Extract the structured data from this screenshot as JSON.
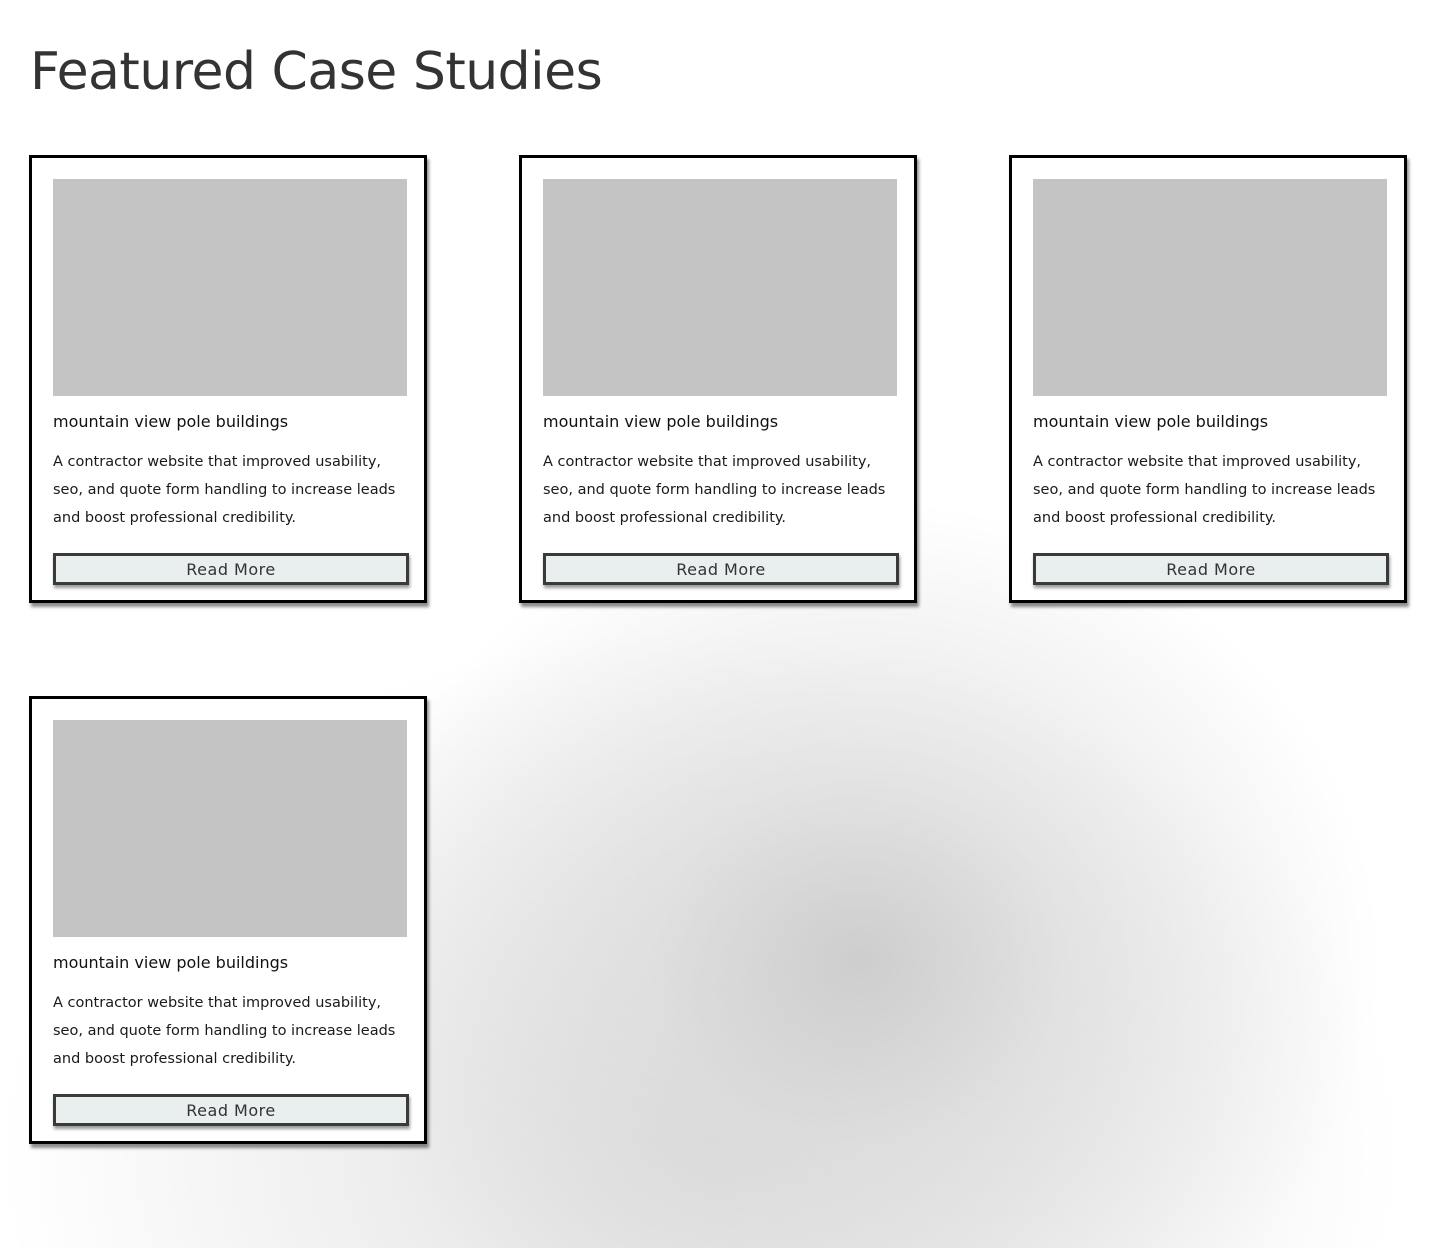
{
  "header": {
    "title": "Featured Case Studies"
  },
  "cards": [
    {
      "title": "mountain view pole buildings",
      "description": "A contractor website that improved usability, seo, and quote form handling to increase leads and boost professional credibility.",
      "button_label": "Read More"
    },
    {
      "title": "mountain view pole buildings",
      "description": "A contractor website that improved usability, seo, and quote form handling to increase leads and boost professional credibility.",
      "button_label": "Read More"
    },
    {
      "title": "mountain view pole buildings",
      "description": "A contractor website that improved usability, seo, and quote form handling to increase leads and boost professional credibility.",
      "button_label": "Read More"
    },
    {
      "title": "mountain view pole buildings",
      "description": "A contractor website that improved usability, seo, and quote form handling to increase leads and boost professional credibility.",
      "button_label": "Read More"
    }
  ],
  "colors": {
    "title_text": "#333333",
    "card_border": "#000000",
    "image_placeholder": "#c4c4c4",
    "button_background": "#e9eeee",
    "button_border": "#3a3a3a"
  }
}
